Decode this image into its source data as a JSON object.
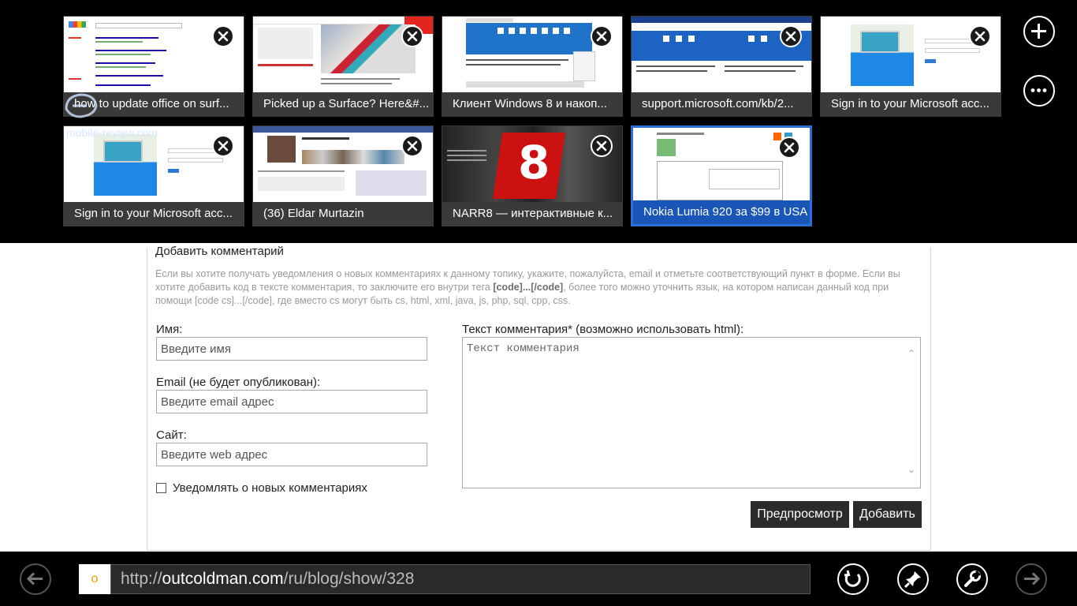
{
  "tabs": [
    {
      "title": "how to update office on surf..."
    },
    {
      "title": "Picked up a Surface? Here&#..."
    },
    {
      "title": "Клиент Windows 8 и накоп..."
    },
    {
      "title": "support.microsoft.com/kb/2..."
    },
    {
      "title": "Sign in to your Microsoft acc..."
    },
    {
      "title": "Sign in to your Microsoft acc..."
    },
    {
      "title": "(36) Eldar Murtazin"
    },
    {
      "title": "NARR8 — интерактивные к..."
    },
    {
      "title": "Nokia Lumia 920 за $99 в USA"
    }
  ],
  "watermark": "mobile-review.com",
  "narr_digit": "8",
  "comment_form": {
    "title": "Добавить комментарий",
    "intro_1": "Если вы хотите получать уведомления о новых комментариях к данному топику, укажите, пожалуйста, email и отметьте соответствующий пункт в форме. Если вы хотите добавить код в тексте комментария, то заключите его внутри тега ",
    "intro_code": "[code]...[/code]",
    "intro_2": ", более того можно уточнить язык, на котором написан данный код при помощи [code cs]...[/code], где вместо cs могут быть cs, html, xml, java, js, php, sql, cpp, css.",
    "name_label": "Имя:",
    "name_placeholder": "Введите имя",
    "email_label": "Email (не будет опубликован):",
    "email_placeholder": "Введите email адрес",
    "site_label": "Сайт:",
    "site_placeholder": "Введите web адрес",
    "notify_label": "Уведомлять о новых комментариях",
    "comment_label": "Текст комментария* (возможно использовать html):",
    "comment_placeholder": "Текст комментария",
    "preview_button": "Предпросмотр",
    "submit_button": "Добавить"
  },
  "address_bar": {
    "favicon": "o",
    "scheme": "http://",
    "host": "outcoldman.com",
    "path": "/ru/blog/show/328"
  }
}
